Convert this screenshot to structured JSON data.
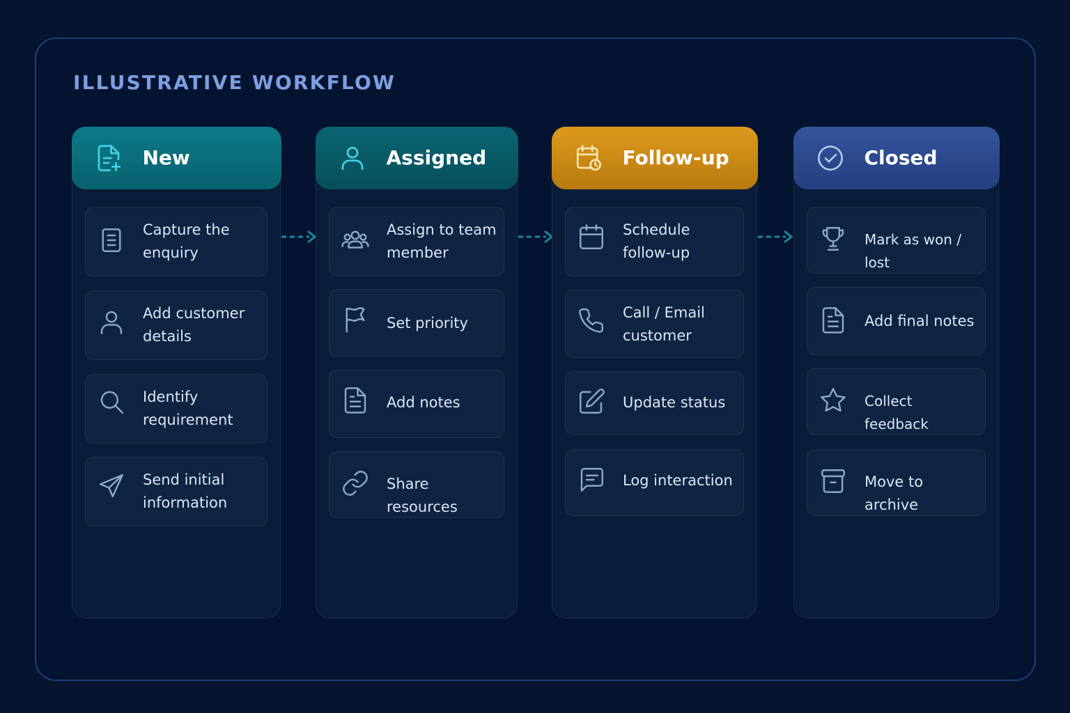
{
  "title": "ILLUSTRATIVE WORKFLOW",
  "colors": {
    "background": "#061430",
    "teal_header": "#0b6f7e",
    "teal_dark_header": "#085a66",
    "amber_header": "#d38f16",
    "blue_header": "#2c4a92",
    "icon_teal": "#3ec8e0",
    "icon_muted": "#8fa6c6",
    "arrow": "#1a8aa0"
  },
  "columns": [
    {
      "title": "New",
      "header_icon": "file-plus-icon",
      "cards": [
        {
          "icon": "document-icon",
          "text": "Capture the enquiry"
        },
        {
          "icon": "user-icon",
          "text": "Add customer details"
        },
        {
          "icon": "search-icon",
          "text": "Identify requirement"
        },
        {
          "icon": "send-icon",
          "text": "Send initial information"
        }
      ]
    },
    {
      "title": "Assigned",
      "header_icon": "user-icon",
      "cards": [
        {
          "icon": "users-icon",
          "text": "Assign to team member"
        },
        {
          "icon": "flag-icon",
          "text": "Set priority"
        },
        {
          "icon": "file-text-icon",
          "text": "Add notes"
        },
        {
          "icon": "link-icon",
          "text": "Share resources"
        }
      ]
    },
    {
      "title": "Follow-up",
      "header_icon": "calendar-clock-icon",
      "cards": [
        {
          "icon": "calendar-icon",
          "text": "Schedule follow-up"
        },
        {
          "icon": "phone-icon",
          "text": "Call / Email customer"
        },
        {
          "icon": "edit-icon",
          "text": "Update status"
        },
        {
          "icon": "chat-icon",
          "text": "Log interaction"
        }
      ]
    },
    {
      "title": "Closed",
      "header_icon": "check-circle-icon",
      "cards": [
        {
          "icon": "trophy-icon",
          "text": "Mark as won / lost"
        },
        {
          "icon": "file-text-icon",
          "text": "Add final notes"
        },
        {
          "icon": "star-icon",
          "text": "Collect feedback"
        },
        {
          "icon": "archive-icon",
          "text": "Move to archive"
        }
      ]
    }
  ]
}
